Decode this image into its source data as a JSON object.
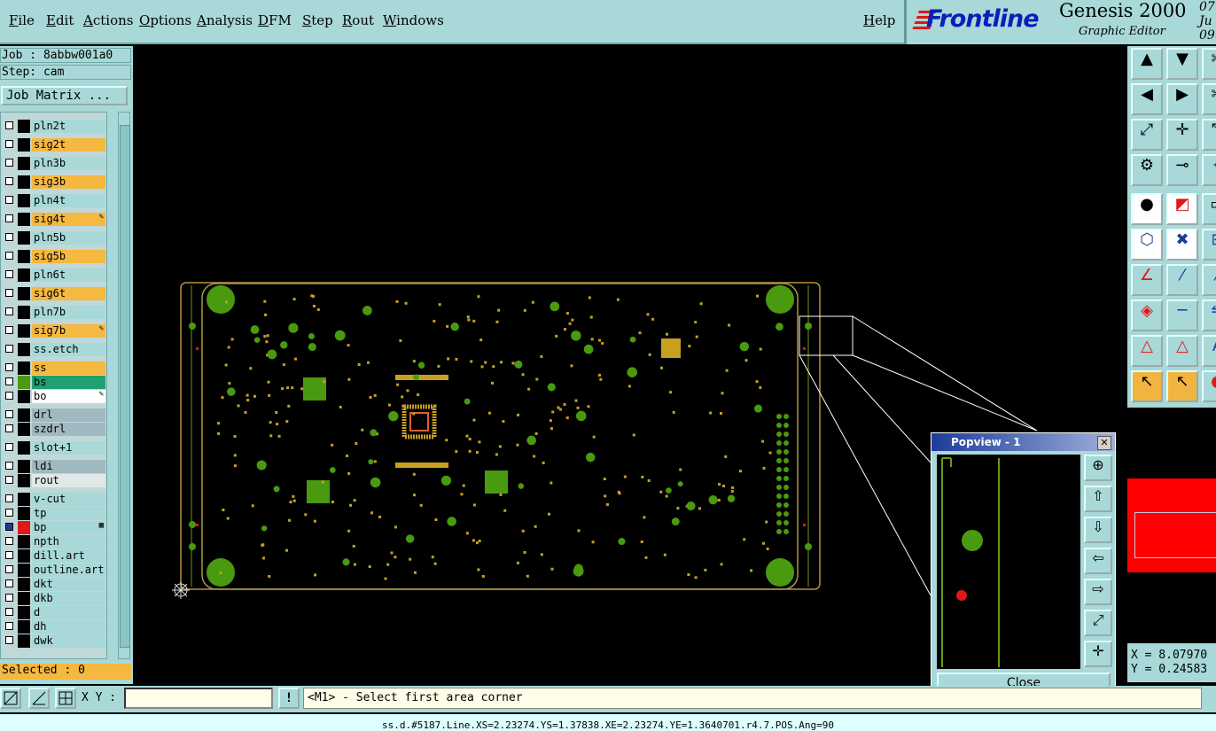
{
  "menubar": {
    "items": [
      "File",
      "Edit",
      "Actions",
      "Options",
      "Analysis",
      "DFM",
      "Step",
      "Rout",
      "Windows"
    ],
    "help": "Help"
  },
  "brand": {
    "logo": "Frontline",
    "product": "Genesis 2000",
    "subtitle": "Graphic Editor",
    "date_line1": "07 Ju",
    "date_line2": "09:"
  },
  "job": {
    "label": "Job : 8abbw001a0",
    "step": "Step: cam",
    "matrix_button": "Job Matrix ..."
  },
  "layers": [
    {
      "name": "pln2t",
      "color": "#a8d8d8",
      "mark": ""
    },
    {
      "name": "sig2t",
      "color": "#f5b840",
      "mark": ""
    },
    {
      "name": "pln3b",
      "color": "#a8d8d8",
      "mark": ""
    },
    {
      "name": "sig3b",
      "color": "#f5b840",
      "mark": ""
    },
    {
      "name": "pln4t",
      "color": "#a8d8d8",
      "mark": ""
    },
    {
      "name": "sig4t",
      "color": "#f5b840",
      "mark": "✎"
    },
    {
      "name": "pln5b",
      "color": "#a8d8d8",
      "mark": ""
    },
    {
      "name": "sig5b",
      "color": "#f5b840",
      "mark": ""
    },
    {
      "name": "pln6t",
      "color": "#a8d8d8",
      "mark": ""
    },
    {
      "name": "sig6t",
      "color": "#f5b840",
      "mark": ""
    },
    {
      "name": "pln7b",
      "color": "#a8d8d8",
      "mark": ""
    },
    {
      "name": "sig7b",
      "color": "#f5b840",
      "mark": "✎"
    },
    {
      "name": "ss.etch",
      "color": "#a8d8d8",
      "mark": ""
    },
    {
      "name": "ss",
      "color": "#f5b840",
      "mark": ""
    },
    {
      "name": "bs",
      "color": "#20a070",
      "mark": ""
    },
    {
      "name": "bo",
      "color": "#ffffff",
      "mark": "✎"
    },
    {
      "name": "drl",
      "color": "#a0b8c0",
      "mark": ""
    },
    {
      "name": "szdrl",
      "color": "#a0b8c0",
      "mark": ""
    },
    {
      "name": "slot+1",
      "color": "#a8d8d8",
      "mark": ""
    },
    {
      "name": "ldi",
      "color": "#a0b8c0",
      "mark": ""
    },
    {
      "name": "rout",
      "color": "#e0e8e8",
      "mark": ""
    },
    {
      "name": "v-cut",
      "color": "#a8d8d8",
      "mark": ""
    },
    {
      "name": "tp",
      "color": "#a8d8d8",
      "mark": ""
    },
    {
      "name": "bp",
      "color": "#a8d8d8",
      "mark": "▦"
    },
    {
      "name": "npth",
      "color": "#a8d8d8",
      "mark": ""
    },
    {
      "name": "dill.art",
      "color": "#a8d8d8",
      "mark": ""
    },
    {
      "name": "outline.art",
      "color": "#a8d8d8",
      "mark": ""
    },
    {
      "name": "dkt",
      "color": "#a8d8d8",
      "mark": ""
    },
    {
      "name": "dkb",
      "color": "#a8d8d8",
      "mark": ""
    },
    {
      "name": "d",
      "color": "#a8d8d8",
      "mark": ""
    },
    {
      "name": "dh",
      "color": "#a8d8d8",
      "mark": ""
    },
    {
      "name": "dwk",
      "color": "#a8d8d8",
      "mark": ""
    }
  ],
  "selected": "Selected : 0",
  "bottombar": {
    "xy_label": "X Y :",
    "xy_value": "",
    "warn_icon": "!",
    "message": "<M1> - Select first area corner"
  },
  "status_line": "ss.d.#5187.Line.XS=2.23274.YS=1.37838.XE=2.23274.YE=1.3640701.r4.7.POS.Ang=90",
  "coords": {
    "x": "X = 8.07970",
    "y": "Y = 0.24583"
  },
  "popview": {
    "title": "Popview - 1",
    "close_x": "✕",
    "close_button": "Close"
  },
  "colors": {
    "panel": "#a8d8d8",
    "accent": "#f5b840",
    "pad_green": "#4a9a10",
    "copper_gold": "#c8a020",
    "board_outline": "#b89040"
  }
}
